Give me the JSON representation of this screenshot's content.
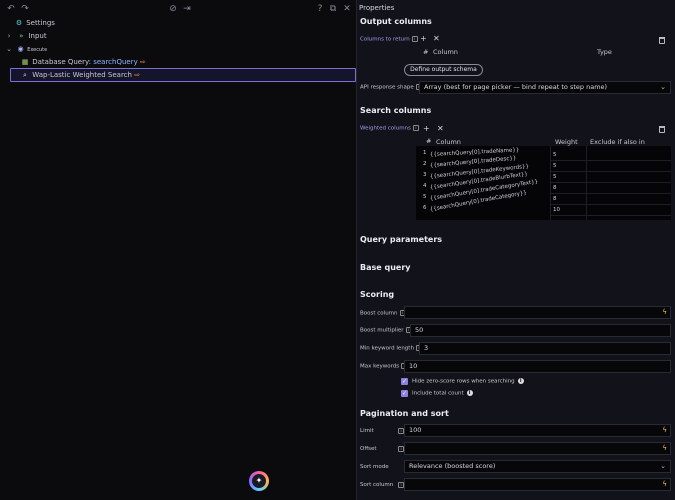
{
  "tree": {
    "settings": "Settings",
    "input": "Input",
    "execute": "Execute",
    "db_query_prefix": "Database Query:",
    "db_query_name": "searchQuery",
    "weighted": "Wap-Lastic Weighted Search"
  },
  "properties": {
    "header": "Properties",
    "output_columns": {
      "title": "Output columns",
      "columns_to_return": "Columns to return",
      "hash": "#",
      "col_column": "Column",
      "col_type": "Type",
      "define_schema": "Define output schema",
      "api_shape_label": "API response shape",
      "api_shape_value": "Array (best for page picker — bind repeat to step name)"
    },
    "search_columns": {
      "title": "Search columns",
      "weighted_label": "Weighted columns",
      "hash": "#",
      "col_column": "Column",
      "col_weight": "Weight",
      "col_exclude": "Exclude if also in",
      "rows": [
        {
          "n": "1",
          "column": "{{searchQuery[0].tradeName}}",
          "weight": "5"
        },
        {
          "n": "2",
          "column": "{{searchQuery[0].tradeDesc}}",
          "weight": "5"
        },
        {
          "n": "3",
          "column": "{{searchQuery[0].tradeKeywords}}",
          "weight": "5"
        },
        {
          "n": "4",
          "column": "{{searchQuery[0].tradeBlurbText}}",
          "weight": "8"
        },
        {
          "n": "5",
          "column": "{{searchQuery[0].tradeCategoryText}}",
          "weight": "8"
        },
        {
          "n": "6",
          "column": "{{searchQuery[0].tradeCategory}}",
          "weight": "10"
        }
      ]
    },
    "query_parameters": {
      "title": "Query parameters"
    },
    "base_query": {
      "title": "Base query"
    },
    "scoring": {
      "title": "Scoring",
      "boost_column_label": "Boost column",
      "boost_column_value": "",
      "boost_multiplier_label": "Boost multiplier",
      "boost_multiplier_value": "50",
      "min_keyword_label": "Min keyword length",
      "min_keyword_value": "3",
      "max_keywords_label": "Max keywords",
      "max_keywords_value": "10",
      "hide_zero_label": "Hide zero-score rows when searching",
      "include_total_label": "Include total count"
    },
    "pagination": {
      "title": "Pagination and sort",
      "limit_label": "Limit",
      "limit_value": "100",
      "offset_label": "Offset",
      "offset_value": "",
      "sort_mode_label": "Sort mode",
      "sort_mode_value": "Relevance (boosted score)",
      "sort_column_label": "Sort column",
      "sort_column_value": ""
    }
  },
  "colors": {
    "accent": "#8b7fe0",
    "bolt": "#e8c547",
    "panel": "#12121a",
    "canvas": "#0b0b0e"
  }
}
